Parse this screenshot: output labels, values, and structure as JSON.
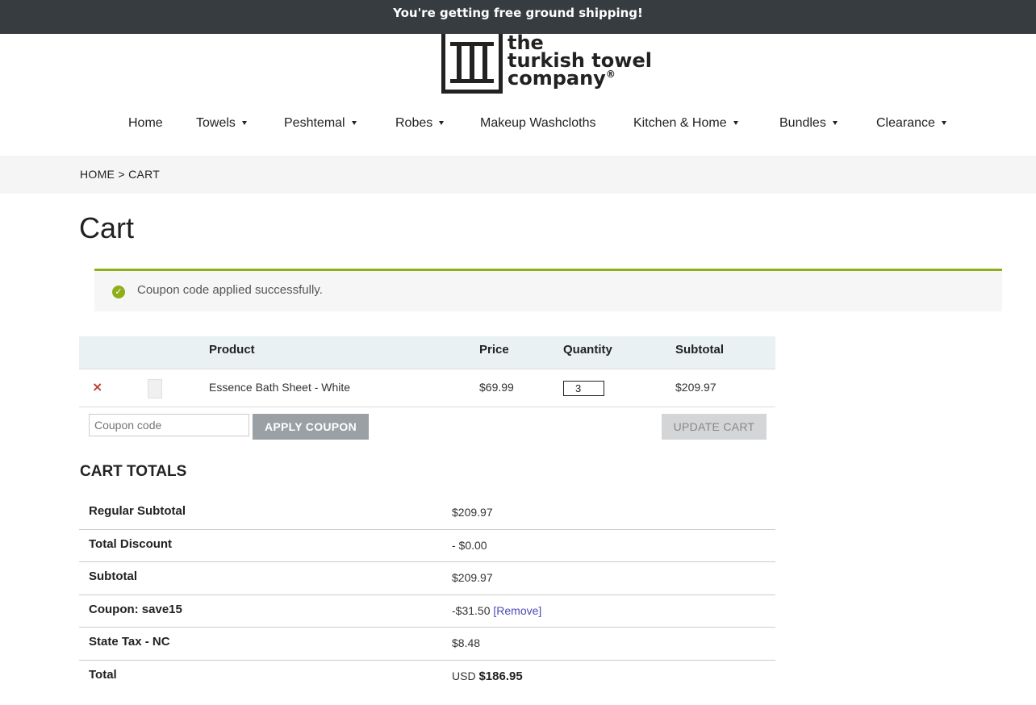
{
  "banner": {
    "text": "You're getting free ground shipping!"
  },
  "logo": {
    "line1": "the",
    "line2": "turkish towel",
    "line3": "company",
    "reg": "®"
  },
  "nav": {
    "items": [
      {
        "label": "Home",
        "caret": false
      },
      {
        "label": "Towels",
        "caret": true
      },
      {
        "label": "Peshtemal",
        "caret": true
      },
      {
        "label": "Robes",
        "caret": true
      },
      {
        "label": "Makeup Washcloths",
        "caret": false
      },
      {
        "label": "Kitchen & Home",
        "caret": true
      },
      {
        "label": "Bundles",
        "caret": true
      },
      {
        "label": "Clearance",
        "caret": true
      }
    ]
  },
  "breadcrumb": {
    "home": "HOME",
    "sep": ">",
    "current": "CART"
  },
  "page": {
    "title": "Cart"
  },
  "notice": {
    "icon": "check-circle-icon",
    "text": "Coupon code applied successfully.",
    "accent": "#8fae1b"
  },
  "cart": {
    "headers": {
      "product": "Product",
      "price": "Price",
      "quantity": "Quantity",
      "subtotal": "Subtotal"
    },
    "items": [
      {
        "remove": "×",
        "name": "Essence Bath Sheet - White",
        "price": "$69.99",
        "quantity": "3",
        "subtotal": "$209.97"
      }
    ],
    "coupon_placeholder": "Coupon code",
    "apply_label": "APPLY COUPON",
    "update_label": "UPDATE CART"
  },
  "totals": {
    "title": "CART TOTALS",
    "regular_subtotal": {
      "label": "Regular Subtotal",
      "value": "$209.97"
    },
    "total_discount": {
      "label": "Total Discount",
      "value": "- $0.00"
    },
    "subtotal": {
      "label": "Subtotal",
      "value": "$209.97"
    },
    "coupon": {
      "label": "Coupon: save15",
      "value": "-$31.50",
      "remove": "[Remove]"
    },
    "tax": {
      "label": "State Tax - NC",
      "value": "$8.48"
    },
    "total": {
      "label": "Total",
      "currency": "USD",
      "value": "$186.95"
    }
  }
}
